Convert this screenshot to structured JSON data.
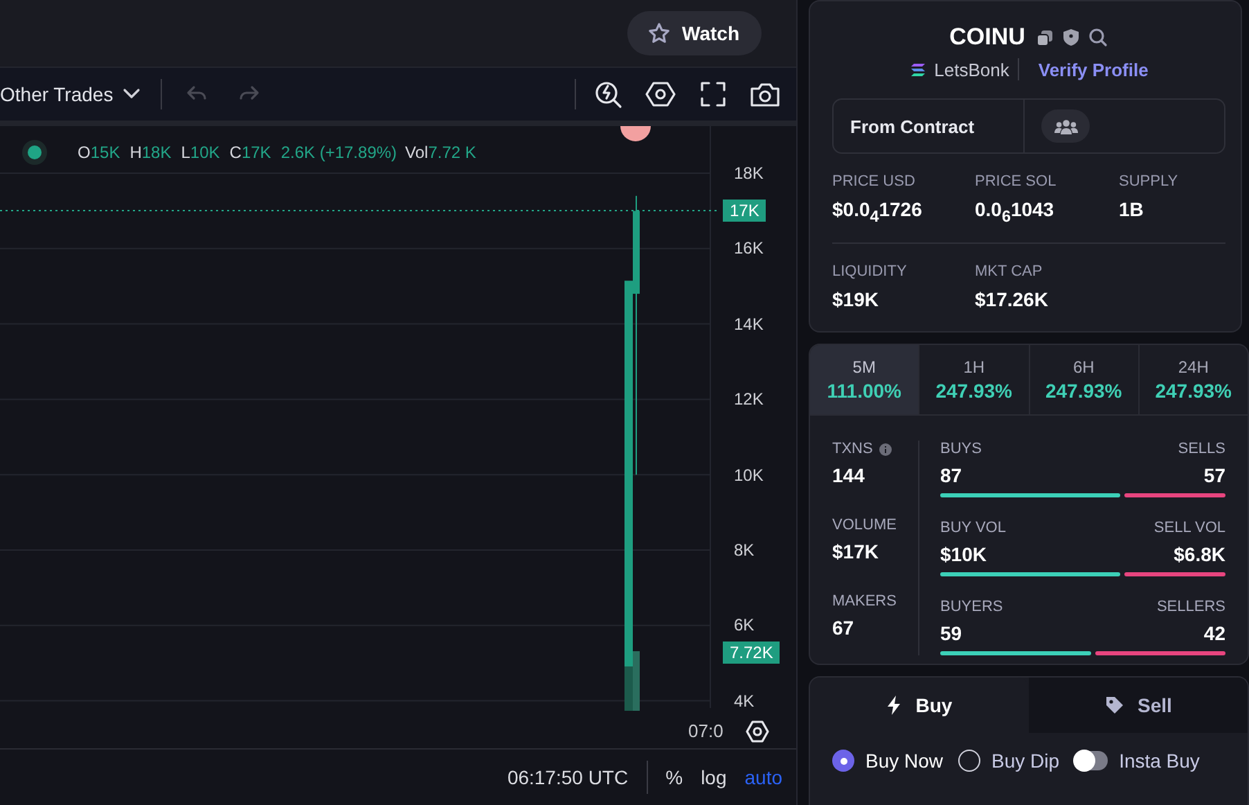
{
  "header": {
    "watch_button": "Watch"
  },
  "toolbar": {
    "trades_dropdown": "Other Trades"
  },
  "legend": {
    "ohlc": [
      {
        "label": "O",
        "value": "15K"
      },
      {
        "label": "H",
        "value": "18K"
      },
      {
        "label": "L",
        "value": "10K"
      },
      {
        "label": "C",
        "value": "17K"
      }
    ],
    "change": "2.6K (+17.89%)",
    "volume_label": "Vol",
    "volume_value": "7.72 K"
  },
  "price_axis": {
    "ticks": [
      "18K",
      "16K",
      "14K",
      "12K",
      "10K",
      "8K",
      "6K",
      "4K"
    ],
    "last_price": "17K",
    "volume_marker": "7.72K"
  },
  "time_axis": {
    "label": "07:0"
  },
  "bottom_bar": {
    "time": "06:17:50 UTC",
    "scale_options": [
      {
        "label": "%",
        "selected": false
      },
      {
        "label": "log",
        "selected": false
      },
      {
        "label": "auto",
        "selected": true
      }
    ]
  },
  "token": {
    "symbol": "COINU",
    "platform": "LetsBonk",
    "verify_link": "Verify Profile",
    "source": "From Contract",
    "stats": [
      {
        "label": "PRICE USD",
        "value": "$0.0$_{4}$1726"
      },
      {
        "label": "PRICE SOL",
        "value": "0.0$_{6}$1043"
      },
      {
        "label": "SUPPLY",
        "value": "1B"
      },
      {
        "label": "LIQUIDITY",
        "value": "$19K"
      },
      {
        "label": "MKT CAP",
        "value": "$17.26K"
      }
    ]
  },
  "periods": [
    {
      "label": "5M",
      "value": "111.00%",
      "selected": true
    },
    {
      "label": "1H",
      "value": "247.93%",
      "selected": false
    },
    {
      "label": "6H",
      "value": "247.93%",
      "selected": false
    },
    {
      "label": "24H",
      "value": "247.93%",
      "selected": false
    }
  ],
  "totals": [
    {
      "label": "TXNS",
      "value": "144"
    },
    {
      "label": "VOLUME",
      "value": "$17K"
    },
    {
      "label": "MAKERS",
      "value": "67"
    }
  ],
  "splits": [
    {
      "buy_label": "BUYS",
      "buy_value": "87",
      "sell_label": "SELLS",
      "sell_value": "57",
      "level": 0.63
    },
    {
      "buy_label": "BUY VOL",
      "buy_value": "$10K",
      "sell_label": "SELL VOL",
      "sell_value": "$6.8K",
      "level": 0.63
    },
    {
      "buy_label": "BUYERS",
      "buy_value": "59",
      "sell_label": "SELLERS",
      "sell_value": "42",
      "level": 0.53
    }
  ],
  "trade": {
    "tabs": [
      {
        "label": "Buy",
        "selected": true
      },
      {
        "label": "Sell",
        "selected": false
      }
    ],
    "options": [
      {
        "kind": "radio",
        "label": "Buy Now",
        "checked": true
      },
      {
        "kind": "radio",
        "label": "Buy Dip",
        "checked": false
      },
      {
        "kind": "toggle",
        "label": "Insta Buy",
        "on": false
      }
    ]
  }
}
